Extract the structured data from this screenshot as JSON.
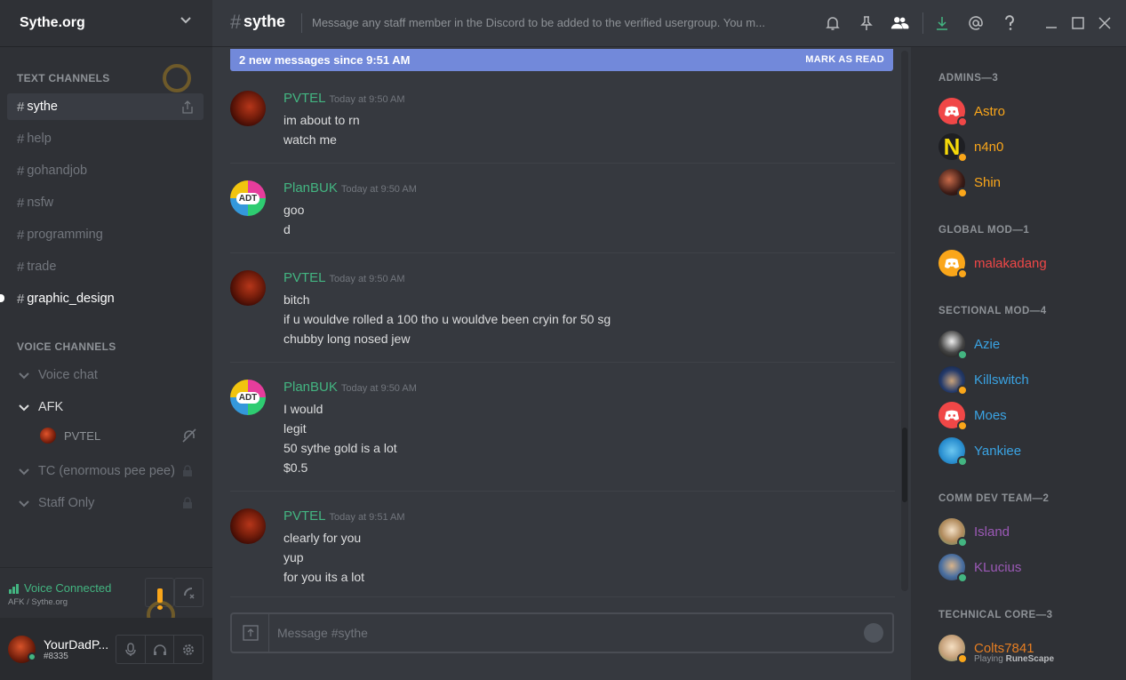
{
  "server": {
    "name": "Sythe.org"
  },
  "sections": {
    "text": "TEXT CHANNELS",
    "voice": "VOICE CHANNELS"
  },
  "text_channels": [
    {
      "name": "sythe",
      "state": "active"
    },
    {
      "name": "help",
      "state": "muted"
    },
    {
      "name": "gohandjob",
      "state": "muted"
    },
    {
      "name": "nsfw",
      "state": "muted"
    },
    {
      "name": "programming",
      "state": "muted"
    },
    {
      "name": "trade",
      "state": "muted"
    },
    {
      "name": "graphic_design",
      "state": "unread"
    }
  ],
  "voice_channels": [
    {
      "name": "Voice chat",
      "open": false,
      "locked": false
    },
    {
      "name": "AFK",
      "open": true,
      "locked": false
    },
    {
      "name": "TC (enormous pee pee)",
      "open": false,
      "locked": true
    },
    {
      "name": "Staff Only",
      "open": false,
      "locked": true
    }
  ],
  "voice_user": {
    "name": "PVTEL"
  },
  "voice_status": {
    "label": "Voice Connected",
    "sub": "AFK / Sythe.org"
  },
  "user": {
    "name": "YourDadP...",
    "tag": "#8335"
  },
  "topbar": {
    "hash": "#",
    "channel": "sythe",
    "topic": "Message any staff member in the Discord to be added to the verified usergroup. You m..."
  },
  "new_messages": {
    "text": "2 new messages since 9:51 AM",
    "action": "MARK AS READ"
  },
  "messages": [
    {
      "author": "PVTEL",
      "time": "Today at 9:50 AM",
      "avatar": "pvtel",
      "lines": [
        "im about to rn",
        "watch me"
      ]
    },
    {
      "author": "PlanBUK",
      "time": "Today at 9:50 AM",
      "avatar": "plan",
      "lines": [
        "goo",
        "d"
      ]
    },
    {
      "author": "PVTEL",
      "time": "Today at 9:50 AM",
      "avatar": "pvtel",
      "lines": [
        "bitch",
        "if u wouldve rolled a 100 tho u wouldve been cryin for 50 sg",
        "chubby long nosed jew"
      ]
    },
    {
      "author": "PlanBUK",
      "time": "Today at 9:50 AM",
      "avatar": "plan",
      "lines": [
        "I would",
        "legit",
        "50 sythe gold is a lot",
        "$0.5"
      ]
    },
    {
      "author": "PVTEL",
      "time": "Today at 9:51 AM",
      "avatar": "pvtel",
      "lines": [
        "clearly for you",
        "yup",
        "for you its a lot"
      ]
    }
  ],
  "avatar_text": "ADT",
  "composer": {
    "placeholder": "Message #sythe"
  },
  "member_groups": [
    {
      "title": "ADMINS—3",
      "members": [
        {
          "name": "Astro",
          "color": "#faa61a",
          "avatar": "discord-r",
          "status": "#f04747"
        },
        {
          "name": "n4n0",
          "color": "#faa61a",
          "avatar": "n",
          "status": "#faa61a"
        },
        {
          "name": "Shin",
          "color": "#faa61a",
          "avatar": "photo1",
          "status": "#faa61a"
        }
      ]
    },
    {
      "title": "GLOBAL MOD—1",
      "members": [
        {
          "name": "malakadang",
          "color": "#f04747",
          "avatar": "discord-o",
          "status": "#faa61a"
        }
      ]
    },
    {
      "title": "SECTIONAL MOD—4",
      "members": [
        {
          "name": "Azie",
          "color": "#3aa3e3",
          "avatar": "photo2",
          "status": "#43b581"
        },
        {
          "name": "Killswitch",
          "color": "#3aa3e3",
          "avatar": "photo3",
          "status": "#faa61a"
        },
        {
          "name": "Moes",
          "color": "#3aa3e3",
          "avatar": "discord-r",
          "status": "#faa61a"
        },
        {
          "name": "Yankiee",
          "color": "#3aa3e3",
          "avatar": "photo4",
          "status": "#43b581"
        }
      ]
    },
    {
      "title": "COMM DEV TEAM—2",
      "members": [
        {
          "name": "Island",
          "color": "#9b59b6",
          "avatar": "photo5",
          "status": "#43b581"
        },
        {
          "name": "KLucius",
          "color": "#9b59b6",
          "avatar": "photo6",
          "status": "#43b581"
        }
      ]
    },
    {
      "title": "TECHNICAL CORE—3",
      "members": [
        {
          "name": "Colts7841",
          "color": "#e67e22",
          "avatar": "photo7",
          "status": "#faa61a",
          "game_prefix": "Playing",
          "game": "RuneScape"
        }
      ]
    }
  ],
  "icons": {
    "header": [
      "bell-icon",
      "pin-icon",
      "members-icon",
      "download-icon",
      "mention-icon",
      "help-icon",
      "minimize-icon",
      "maximize-icon",
      "close-icon"
    ]
  },
  "colors": {
    "accent": "#7289da",
    "online": "#43b581",
    "idle": "#faa61a",
    "dnd": "#f04747"
  }
}
